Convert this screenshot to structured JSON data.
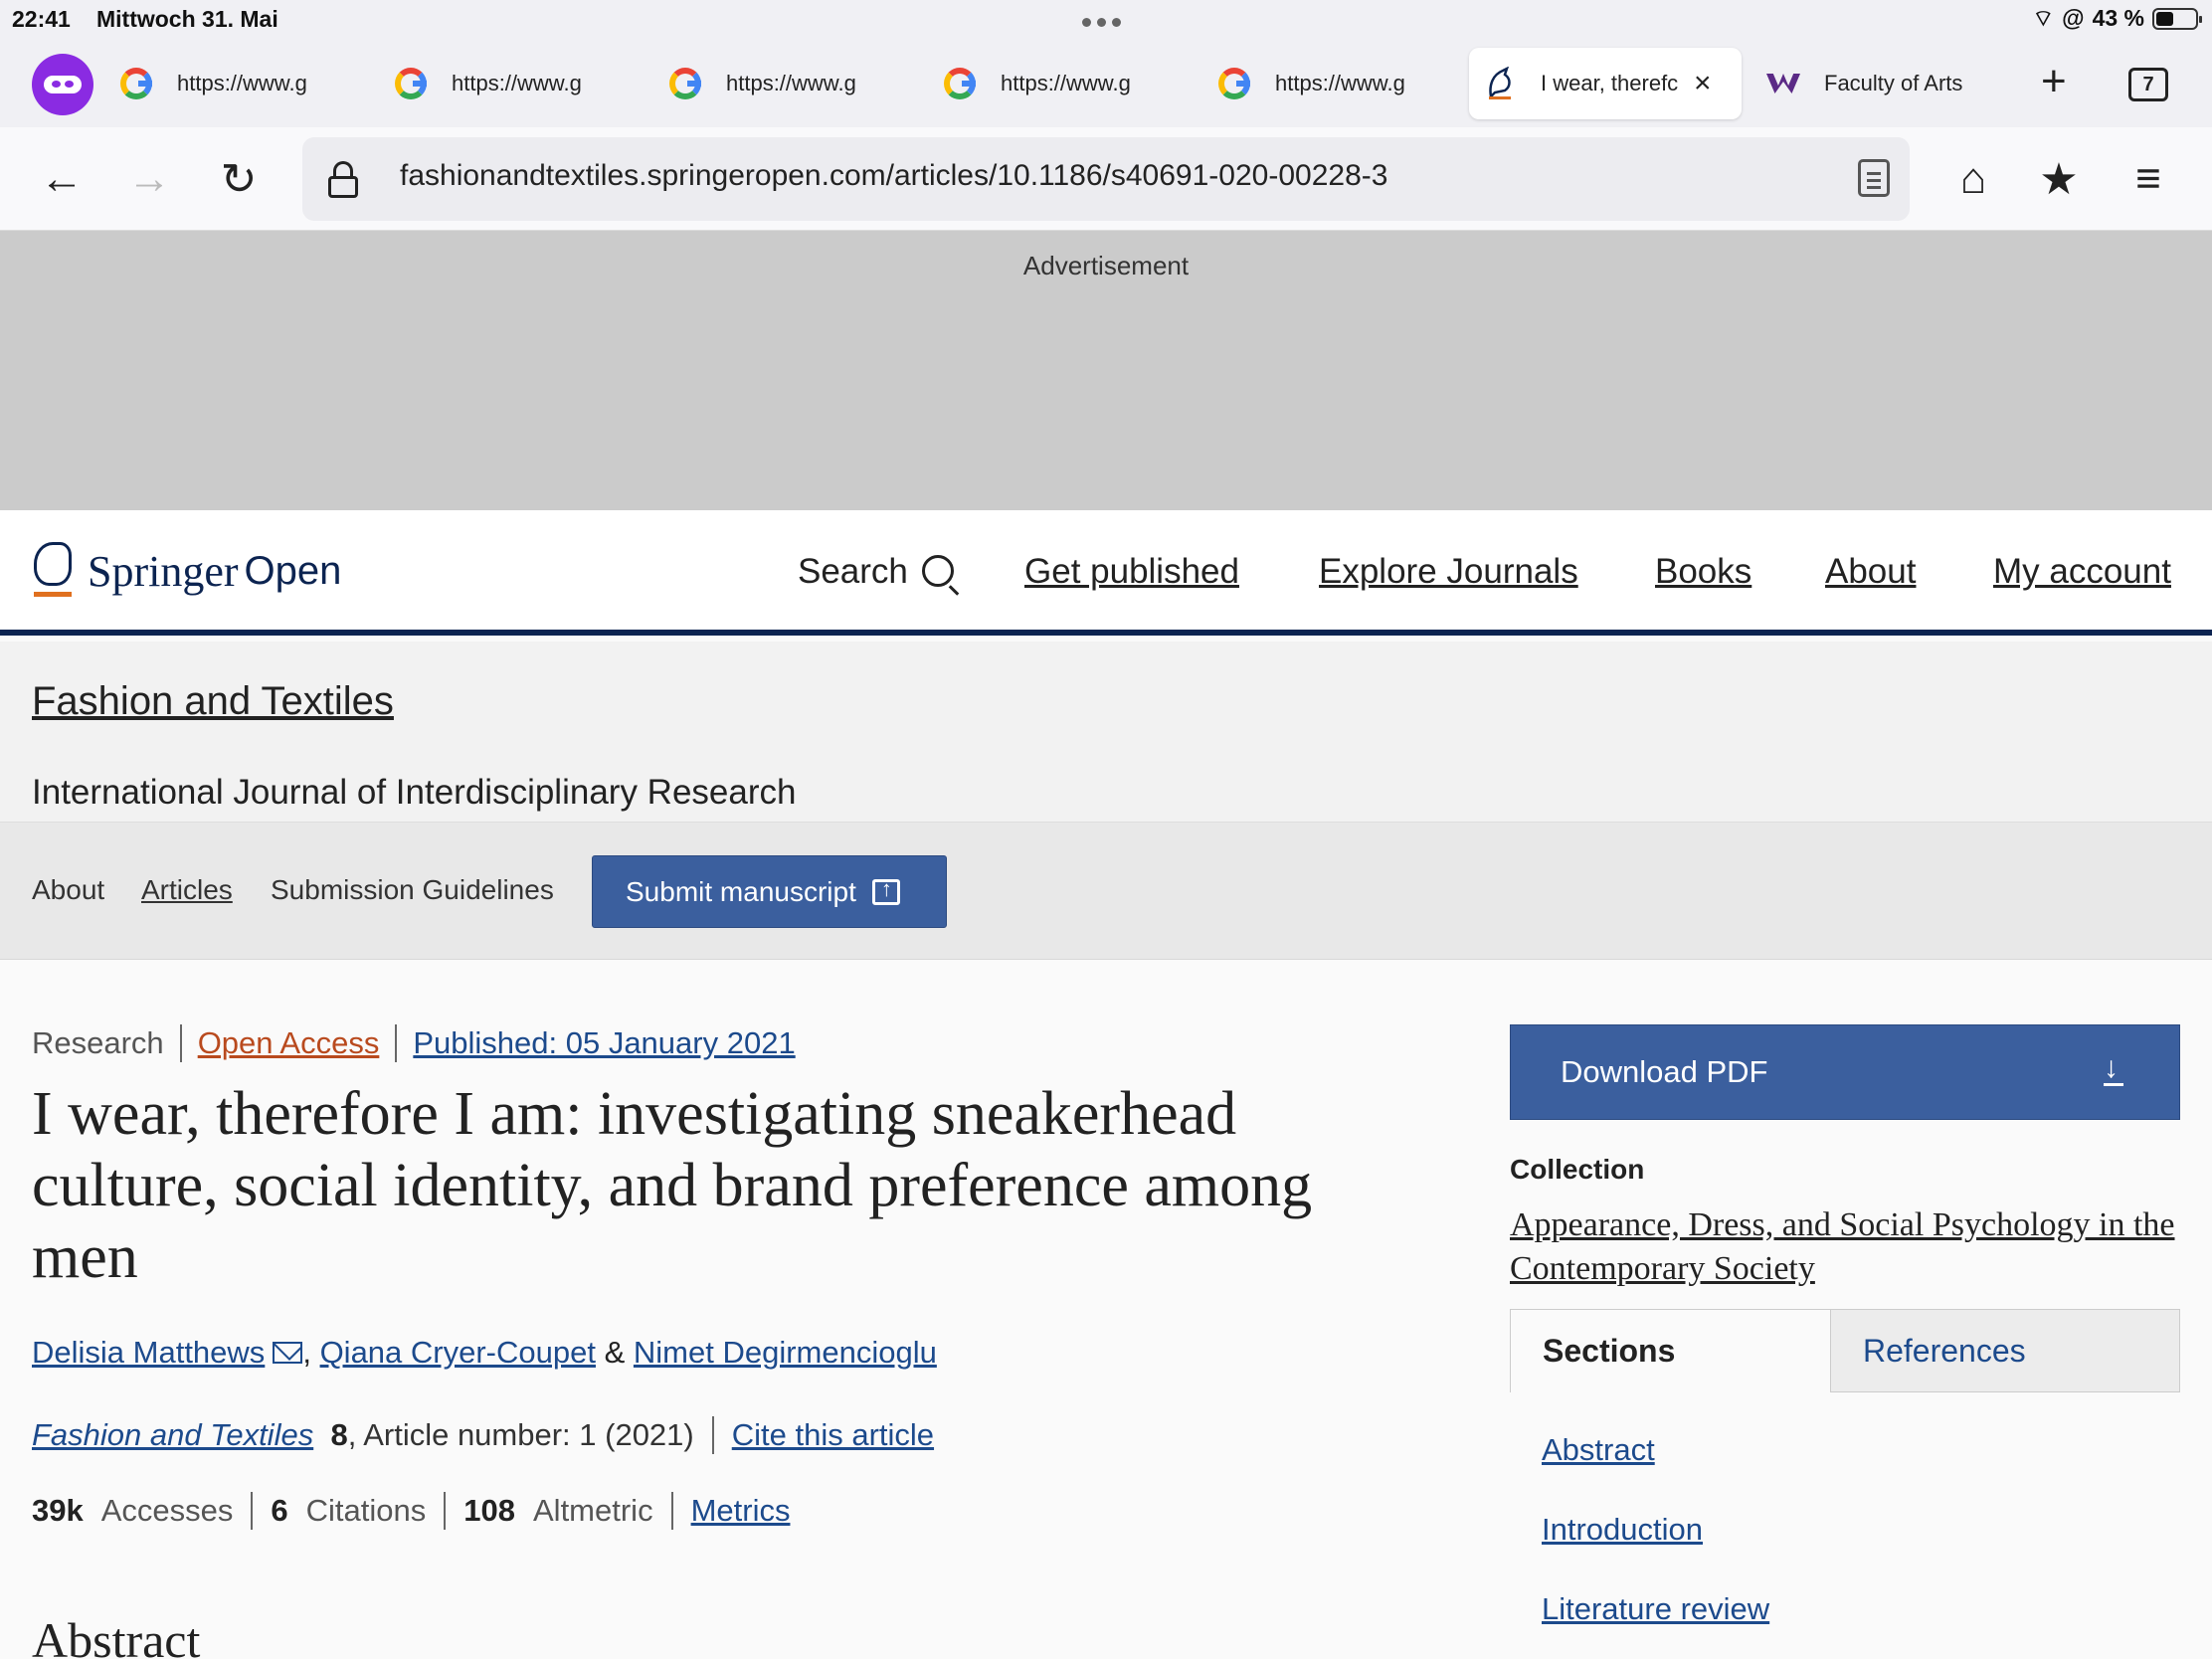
{
  "status_bar": {
    "time": "22:41",
    "date": "Mittwoch 31. Mai",
    "battery": "43 %"
  },
  "tabs": [
    {
      "label": "https://www.g",
      "icon": "google-icon"
    },
    {
      "label": "https://www.g",
      "icon": "google-icon"
    },
    {
      "label": "https://www.g",
      "icon": "google-icon"
    },
    {
      "label": "https://www.g",
      "icon": "google-icon"
    },
    {
      "label": "https://www.g",
      "icon": "google-icon"
    },
    {
      "label": "I wear, therefc",
      "icon": "springer-icon",
      "active": true
    },
    {
      "label": "Faculty of Arts",
      "icon": "w-icon"
    }
  ],
  "tab_count": "7",
  "address_bar": {
    "url": "fashionandtextiles.springeropen.com/articles/10.1186/s40691-020-00228-3"
  },
  "ad": {
    "label": "Advertisement"
  },
  "site_header": {
    "brand": "Springer",
    "brand_suffix": "Open",
    "nav": {
      "search": "Search",
      "get_published": "Get published",
      "explore": "Explore Journals",
      "books": "Books",
      "about": "About",
      "account": "My account"
    }
  },
  "journal": {
    "title": "Fashion and Textiles",
    "subtitle": "International Journal of Interdisciplinary Research",
    "nav": {
      "about": "About",
      "articles": "Articles",
      "guidelines": "Submission Guidelines",
      "submit": "Submit manuscript"
    }
  },
  "article": {
    "type": "Research",
    "access": "Open Access",
    "published": "Published: 05 January 2021",
    "title": "I wear, therefore I am: investigating sneakerhead culture, social identity, and brand preference among men",
    "authors": [
      "Delisia Matthews",
      "Qiana Cryer-Coupet",
      "Nimet Degirmencioglu"
    ],
    "author_sep_1": ",",
    "author_sep_2": "&",
    "journal": "Fashion and Textiles",
    "volume": "8",
    "article_number": ", Article number: 1 (2021)",
    "cite": "Cite this article",
    "metrics": {
      "accesses_value": "39k",
      "accesses_label": "Accesses",
      "citations_value": "6",
      "citations_label": "Citations",
      "altmetric_value": "108",
      "altmetric_label": "Altmetric",
      "link": "Metrics"
    },
    "abstract_heading": "Abstract"
  },
  "sidebar": {
    "download": "Download PDF",
    "collection_label": "Collection",
    "collection": "Appearance, Dress, and Social Psychology in the Contemporary Society",
    "tab_sections": "Sections",
    "tab_references": "References",
    "sections": [
      "Abstract",
      "Introduction",
      "Literature review"
    ]
  },
  "colors": {
    "brand_navy": "#0c2451",
    "button_blue": "#3b5f9e",
    "link_blue": "#1c4a8c",
    "open_access_orange": "#b94a1e",
    "private_purple": "#8a2be2"
  }
}
